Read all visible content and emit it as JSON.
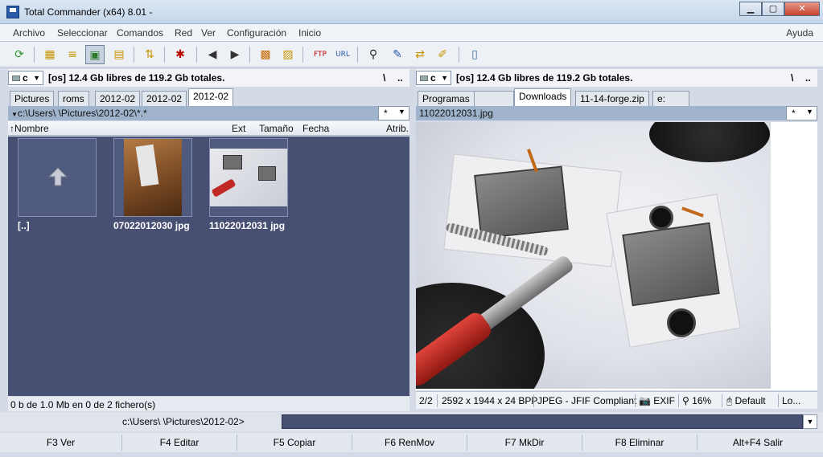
{
  "window": {
    "title": "Total Commander (x64) 8.01 -",
    "min": "▁",
    "max": "▢",
    "close": "✕"
  },
  "menu": [
    "Archivo",
    "Seleccionar",
    "Comandos",
    "Red",
    "Ver",
    "Configuración",
    "Inicio"
  ],
  "menu_help": "Ayuda",
  "toolbar_icons": [
    "refresh-icon",
    "brief-view-icon",
    "full-view-icon",
    "thumbnail-view-icon",
    "tree-view-icon",
    "compare-icon",
    "mark-icon",
    "back-icon",
    "forward-icon",
    "pack-icon",
    "unpack-icon",
    "search-icon",
    "rename-icon",
    "sync-icon",
    "edit-icon",
    "notepad-icon"
  ],
  "left": {
    "drive": "c",
    "drive_info": "[os]  12.4 Gb libres de 119.2 Gb totales.",
    "root": "\\",
    "up": "..",
    "tabs": [
      "Pictures",
      "roms",
      "2012-02",
      "2012-02",
      "2012-02"
    ],
    "path": "c:\\Users\\          \\Pictures\\2012-02\\*.*",
    "filter": "*",
    "columns": {
      "name": "Nombre",
      "ext": "Ext",
      "size": "Tamaño",
      "date": "Fecha",
      "attr": "Atrib."
    },
    "items": [
      {
        "label": "[..]"
      },
      {
        "label": "07022012030 jpg"
      },
      {
        "label": "11022012031 jpg"
      }
    ],
    "status": "0 b de 1.0 Mb en 0 de 2 fichero(s)"
  },
  "right": {
    "drive": "c",
    "drive_info": "[os]  12.4 Gb libres de 119.2 Gb totales.",
    "root": "\\",
    "up": "..",
    "tabs": [
      "Programas",
      "",
      "Downloads",
      "11-14-forge.zip",
      "e:"
    ],
    "path": "11022012031.jpg",
    "filter": "*",
    "status": {
      "index": "2/2",
      "dims": "2592 x 1944 x 24 BPP",
      "format": "JPEG - JFIF Compliant",
      "exif": "EXIF",
      "zoom": "16%",
      "mode": "Default",
      "more": "Lo..."
    }
  },
  "cmd": {
    "prompt": "c:\\Users\\          \\Pictures\\2012-02>"
  },
  "fkeys": [
    "F3 Ver",
    "F4 Editar",
    "F5 Copiar",
    "F6 RenMov",
    "F7 MkDir",
    "F8 Eliminar",
    "Alt+F4 Salir"
  ],
  "colors": {
    "panel_bg": "#474f72",
    "path_bar": "#9fb4cc"
  }
}
